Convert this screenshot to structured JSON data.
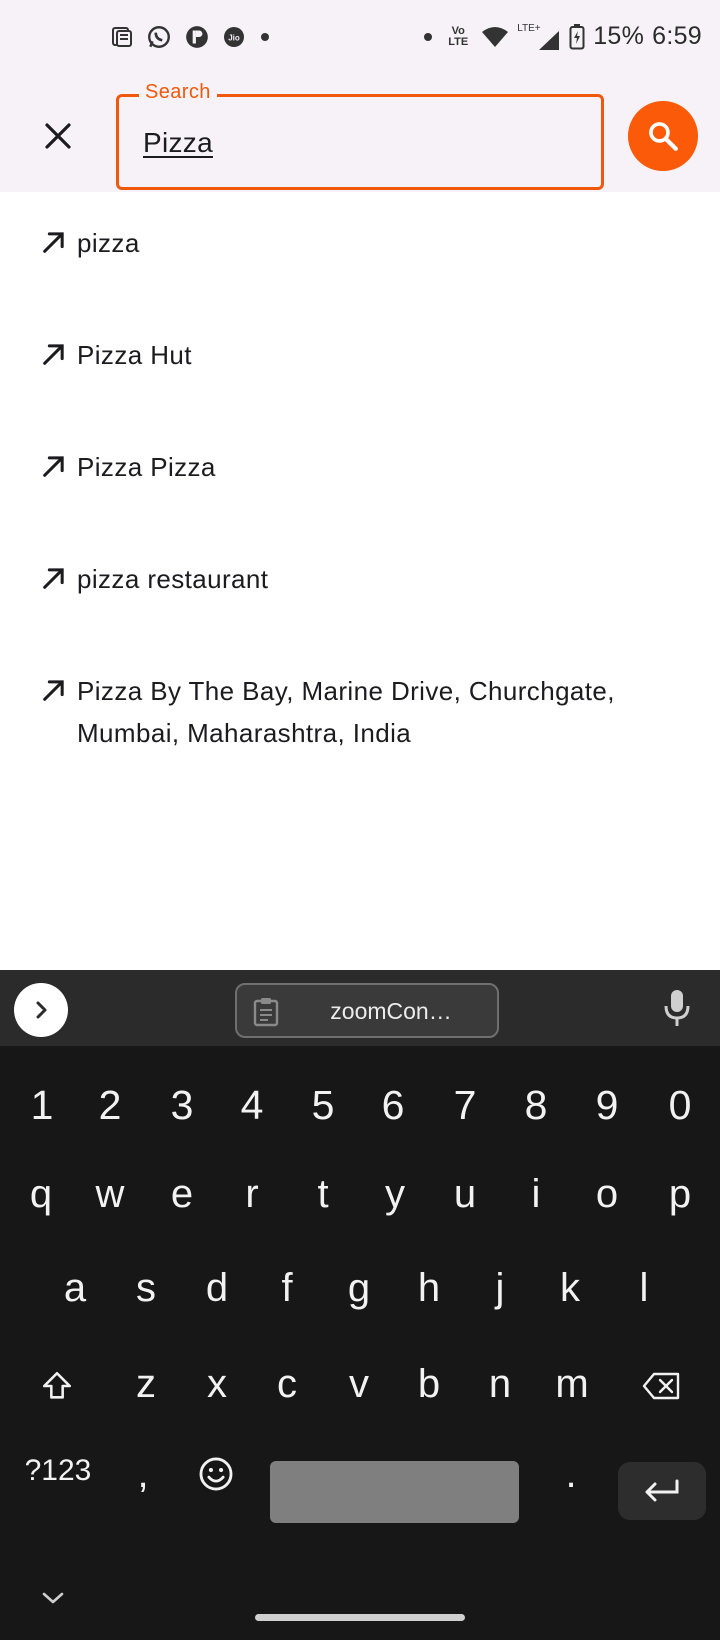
{
  "status_bar": {
    "time": "6:59",
    "battery_percent": "15%",
    "left_icons": [
      "news-icon",
      "whatsapp-icon",
      "app-icon",
      "jio-icon",
      "dot-icon"
    ],
    "right_icons": [
      "dot-icon",
      "volte-icon",
      "wifi-icon",
      "lte-signal-icon",
      "battery-charging-icon"
    ],
    "volte_label": "Vo LTE",
    "lte_label": "LTE+",
    "jio_label": "Jio"
  },
  "search": {
    "legend": "Search",
    "value": "Pizza",
    "accent_color": "#fb5a08"
  },
  "suggestions": [
    {
      "text": "pizza"
    },
    {
      "text": "Pizza Hut"
    },
    {
      "text": "Pizza Pizza"
    },
    {
      "text": "pizza restaurant"
    },
    {
      "text": "Pizza By The Bay, Marine Drive, Churchgate, Mumbai, Maharashtra, India"
    }
  ],
  "keyboard": {
    "clipboard_text": "zoomCon…",
    "number_row": [
      "1",
      "2",
      "3",
      "4",
      "5",
      "6",
      "7",
      "8",
      "9",
      "0"
    ],
    "row1": [
      "q",
      "w",
      "e",
      "r",
      "t",
      "y",
      "u",
      "i",
      "o",
      "p"
    ],
    "row2": [
      "a",
      "s",
      "d",
      "f",
      "g",
      "h",
      "j",
      "k",
      "l"
    ],
    "row3": [
      "z",
      "x",
      "c",
      "v",
      "b",
      "n",
      "m"
    ],
    "symbols_label": "?123",
    "comma": ",",
    "period": "."
  }
}
